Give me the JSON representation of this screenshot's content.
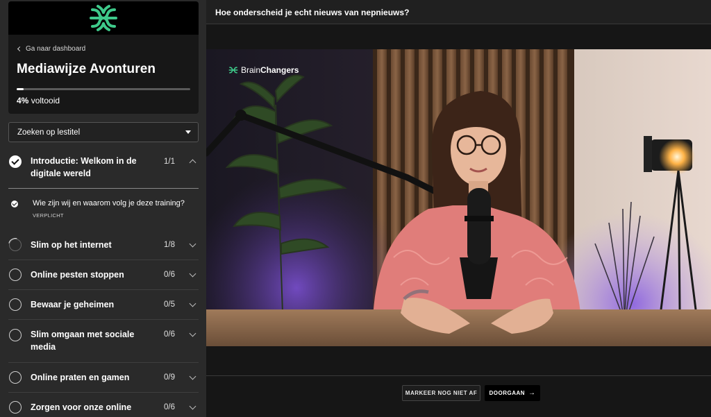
{
  "sidebar": {
    "back_link": "Ga naar dashboard",
    "course_title": "Mediawijze Avonturen",
    "progress_percent": 4,
    "progress_value": "4%",
    "progress_suffix": "voltooid",
    "search_placeholder": "Zoeken op lestitel",
    "sections": [
      {
        "title": "Introductie: Welkom in de digitale wereld",
        "count": "1/1",
        "state": "complete",
        "expanded": true
      },
      {
        "title": "Slim op het internet",
        "count": "1/8",
        "state": "in-progress",
        "expanded": false
      },
      {
        "title": "Online pesten stoppen",
        "count": "0/6",
        "state": "not-started",
        "expanded": false
      },
      {
        "title": "Bewaar je geheimen",
        "count": "0/5",
        "state": "not-started",
        "expanded": false
      },
      {
        "title": "Slim omgaan met sociale media",
        "count": "0/6",
        "state": "not-started",
        "expanded": false
      },
      {
        "title": "Online praten en gamen",
        "count": "0/9",
        "state": "not-started",
        "expanded": false
      },
      {
        "title": "Zorgen voor onze online",
        "count": "0/6",
        "state": "not-started",
        "expanded": false
      }
    ],
    "lesson": {
      "title": "Wie zijn wij en waarom volg je deze training?",
      "tag": "VERPLICHT"
    }
  },
  "main": {
    "lesson_title": "Hoe onderscheid je echt nieuws van nepnieuws?",
    "video_logo_light": "Brain",
    "video_logo_bold": "Changers",
    "mark_button": "MARKEER NOG NIET AF",
    "next_button": "DOORGAAN",
    "next_arrow": "→"
  },
  "colors": {
    "brand_green": "#3ec98a",
    "sidebar_bg": "#2a2a2a",
    "main_bg": "#161616"
  }
}
